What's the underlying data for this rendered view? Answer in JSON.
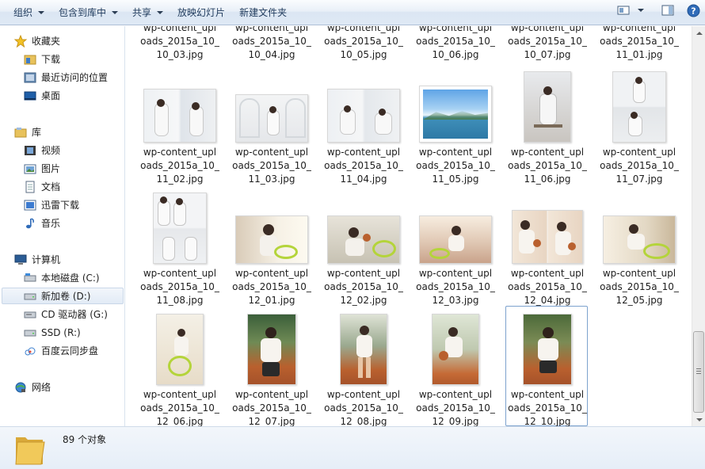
{
  "toolbar": {
    "organize": "组织",
    "include_in_library": "包含到库中",
    "share": "共享",
    "slideshow": "放映幻灯片",
    "new_folder": "新建文件夹",
    "icons": [
      "view-icon",
      "preview-pane-icon",
      "help-icon"
    ]
  },
  "nav": {
    "favorites": "收藏夹",
    "downloads": "下载",
    "recent": "最近访问的位置",
    "desktop": "桌面",
    "libraries": "库",
    "videos": "视频",
    "pictures": "图片",
    "documents": "文档",
    "thunder": "迅雷下载",
    "music": "音乐",
    "computer": "计算机",
    "drive_c": "本地磁盘 (C:)",
    "drive_d": "新加卷 (D:)",
    "drive_g": "CD 驱动器 (G:)",
    "drive_r": "SSD (R:)",
    "baidu": "百度云同步盘",
    "network": "网络"
  },
  "files": {
    "row0_tail": [
      "10_03.jpg",
      "10_04.jpg",
      "10_05.jpg",
      "10_06.jpg",
      "10_07.jpg",
      "11_01.jpg"
    ],
    "rows": [
      [
        {
          "l1": "wp-content_upl",
          "l2": "oads_2015a_10_",
          "l3": "11_02.jpg"
        },
        {
          "l1": "wp-content_upl",
          "l2": "oads_2015a_10_",
          "l3": "11_03.jpg"
        },
        {
          "l1": "wp-content_upl",
          "l2": "oads_2015a_10_",
          "l3": "11_04.jpg"
        },
        {
          "l1": "wp-content_upl",
          "l2": "oads_2015a_10_",
          "l3": "11_05.jpg"
        },
        {
          "l1": "wp-content_upl",
          "l2": "oads_2015a_10_",
          "l3": "11_06.jpg"
        },
        {
          "l1": "wp-content_upl",
          "l2": "oads_2015a_10_",
          "l3": "11_07.jpg"
        }
      ],
      [
        {
          "l1": "wp-content_upl",
          "l2": "oads_2015a_10_",
          "l3": "11_08.jpg"
        },
        {
          "l1": "wp-content_upl",
          "l2": "oads_2015a_10_",
          "l3": "12_01.jpg"
        },
        {
          "l1": "wp-content_upl",
          "l2": "oads_2015a_10_",
          "l3": "12_02.jpg"
        },
        {
          "l1": "wp-content_upl",
          "l2": "oads_2015a_10_",
          "l3": "12_03.jpg"
        },
        {
          "l1": "wp-content_upl",
          "l2": "oads_2015a_10_",
          "l3": "12_04.jpg"
        },
        {
          "l1": "wp-content_upl",
          "l2": "oads_2015a_10_",
          "l3": "12_05.jpg"
        }
      ],
      [
        {
          "l1": "wp-content_upl",
          "l2": "oads_2015a_10_",
          "l3": "12_06.jpg"
        },
        {
          "l1": "wp-content_upl",
          "l2": "oads_2015a_10_",
          "l3": "12_07.jpg"
        },
        {
          "l1": "wp-content_upl",
          "l2": "oads_2015a_10_",
          "l3": "12_08.jpg"
        },
        {
          "l1": "wp-content_upl",
          "l2": "oads_2015a_10_",
          "l3": "12_09.jpg"
        },
        {
          "l1": "wp-content_upl",
          "l2": "oads_2015a_10_",
          "l3": "12_10.jpg"
        }
      ]
    ]
  },
  "status": {
    "count": "89 个对象"
  },
  "colors": {
    "accent": "#1e395b",
    "selection_border": "#7da2ce",
    "status_bg": "#e6eef8"
  }
}
